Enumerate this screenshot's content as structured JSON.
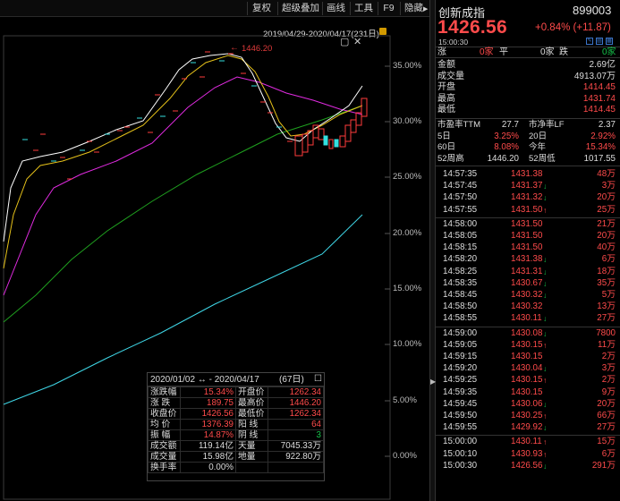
{
  "toolbar": {
    "buttons": [
      "复权",
      "超级叠加",
      "画线",
      "工具",
      "F9",
      "隐藏"
    ],
    "hide_arrow": "▶"
  },
  "chart": {
    "range_label": "2019/04/29-2020/04/17(231日)",
    "peak_label": "1446.20",
    "y_labels": [
      "35.00%",
      "30.00%",
      "25.00%",
      "20.00%",
      "15.00%",
      "10.00%",
      "5.00%",
      "0.00%"
    ],
    "colors": {
      "up_candle": "#ff3b3b",
      "down_candle": "#33e0e0",
      "ma_white": "#ffffff",
      "ma_yellow": "#e6c21a",
      "ma_magenta": "#e02be0",
      "ma_green": "#1fa01f",
      "ma_cyan": "#3fd6e6"
    }
  },
  "stats": {
    "range": "2020/01/02 ↔ - 2020/04/17",
    "days": "(67日)",
    "rows": [
      [
        {
          "k": "涨跌幅",
          "v": "15.34%",
          "c": "#ff4b4b"
        },
        {
          "k": "开盘价",
          "v": "1262.34",
          "c": "#ff4b4b"
        }
      ],
      [
        {
          "k": "涨  跌",
          "v": "189.75",
          "c": "#ff4b4b"
        },
        {
          "k": "最高价",
          "v": "1446.20",
          "c": "#ff4b4b"
        }
      ],
      [
        {
          "k": "收盘价",
          "v": "1426.56",
          "c": "#ff4b4b"
        },
        {
          "k": "最低价",
          "v": "1262.34",
          "c": "#ff4b4b"
        }
      ],
      [
        {
          "k": "均  价",
          "v": "1376.39",
          "c": "#ff4b4b"
        },
        {
          "k": "阳  线",
          "v": "64",
          "c": "#ff4b4b"
        }
      ],
      [
        {
          "k": "振  幅",
          "v": "14.87%",
          "c": "#ff4b4b"
        },
        {
          "k": "阴  线",
          "v": "3",
          "c": "#16c24a"
        }
      ],
      [
        {
          "k": "成交额",
          "v": "119.14亿",
          "c": "#dddddd"
        },
        {
          "k": "天量",
          "v": "7045.33万",
          "c": "#dddddd"
        }
      ],
      [
        {
          "k": "成交量",
          "v": "15.98亿",
          "c": "#dddddd"
        },
        {
          "k": "地量",
          "v": "922.80万",
          "c": "#dddddd"
        }
      ],
      [
        {
          "k": "换手率",
          "v": "0.00%",
          "c": "#dddddd"
        },
        {
          "k": "",
          "v": "",
          "c": "#dddddd"
        }
      ]
    ]
  },
  "quote": {
    "name": "创新成指",
    "code": "899003",
    "last": "1426.56",
    "change": "+0.84% (+11.87)",
    "time": "15:00:30",
    "ask_bid": {
      "zhang": "涨",
      "zhang_v": "0家",
      "ping": "平",
      "ping_v": "0家",
      "die": "跌",
      "die_v": "0家"
    },
    "fields": [
      {
        "k": "金额",
        "v": "2.69亿",
        "c": "#dddddd"
      },
      {
        "k": "成交量",
        "v": "4913.07万",
        "c": "#dddddd"
      },
      {
        "k": "开盘",
        "v": "1414.45",
        "c": "#ff4b4b"
      },
      {
        "k": "最高",
        "v": "1431.74",
        "c": "#ff4b4b"
      },
      {
        "k": "最低",
        "v": "1414.45",
        "c": "#ff4b4b"
      }
    ],
    "metrics": [
      {
        "k1": "市盈率TTM",
        "v1": "27.7",
        "c1": "#dddddd",
        "k2": "市净率LF",
        "v2": "2.37",
        "c2": "#dddddd"
      },
      {
        "k1": "5日",
        "v1": "3.25%",
        "c1": "#ff4b4b",
        "k2": "20日",
        "v2": "2.92%",
        "c2": "#ff4b4b"
      },
      {
        "k1": "60日",
        "v1": "8.08%",
        "c1": "#ff4b4b",
        "k2": "今年",
        "v2": "15.34%",
        "c2": "#ff4b4b"
      },
      {
        "k1": "52周高",
        "v1": "1446.20",
        "c1": "#dddddd",
        "k2": "52周低",
        "v2": "1017.55",
        "c2": "#dddddd"
      }
    ]
  },
  "ticks": [
    {
      "t": "14:57:35",
      "p": "1431.38",
      "a": "",
      "v": "48万"
    },
    {
      "t": "14:57:45",
      "p": "1431.37",
      "a": "down",
      "v": "3万"
    },
    {
      "t": "14:57:50",
      "p": "1431.32",
      "a": "down",
      "v": "20万"
    },
    {
      "t": "14:57:55",
      "p": "1431.50",
      "a": "up",
      "v": "25万"
    },
    {
      "t": "14:58:00",
      "p": "1431.50",
      "a": "",
      "v": "21万"
    },
    {
      "t": "14:58:05",
      "p": "1431.50",
      "a": "",
      "v": "20万"
    },
    {
      "t": "14:58:15",
      "p": "1431.50",
      "a": "",
      "v": "40万"
    },
    {
      "t": "14:58:20",
      "p": "1431.38",
      "a": "down",
      "v": "6万"
    },
    {
      "t": "14:58:25",
      "p": "1431.31",
      "a": "down",
      "v": "18万"
    },
    {
      "t": "14:58:35",
      "p": "1430.67",
      "a": "down",
      "v": "35万"
    },
    {
      "t": "14:58:45",
      "p": "1430.32",
      "a": "down",
      "v": "5万"
    },
    {
      "t": "14:58:50",
      "p": "1430.32",
      "a": "",
      "v": "13万"
    },
    {
      "t": "14:58:55",
      "p": "1430.11",
      "a": "down",
      "v": "27万"
    },
    {
      "t": "14:59:00",
      "p": "1430.08",
      "a": "down",
      "v": "7800"
    },
    {
      "t": "14:59:05",
      "p": "1430.15",
      "a": "up",
      "v": "11万"
    },
    {
      "t": "14:59:15",
      "p": "1430.15",
      "a": "",
      "v": "2万"
    },
    {
      "t": "14:59:20",
      "p": "1430.04",
      "a": "down",
      "v": "3万"
    },
    {
      "t": "14:59:25",
      "p": "1430.15",
      "a": "up",
      "v": "2万"
    },
    {
      "t": "14:59:35",
      "p": "1430.15",
      "a": "",
      "v": "9万"
    },
    {
      "t": "14:59:45",
      "p": "1430.06",
      "a": "down",
      "v": "20万"
    },
    {
      "t": "14:59:50",
      "p": "1430.25",
      "a": "up",
      "v": "66万"
    },
    {
      "t": "14:59:55",
      "p": "1429.92",
      "a": "down",
      "v": "27万"
    },
    {
      "t": "15:00:00",
      "p": "1430.11",
      "a": "up",
      "v": "15万"
    },
    {
      "t": "15:00:10",
      "p": "1430.93",
      "a": "up",
      "v": "6万"
    },
    {
      "t": "15:00:30",
      "p": "1426.56",
      "a": "down",
      "v": "291万"
    }
  ]
}
